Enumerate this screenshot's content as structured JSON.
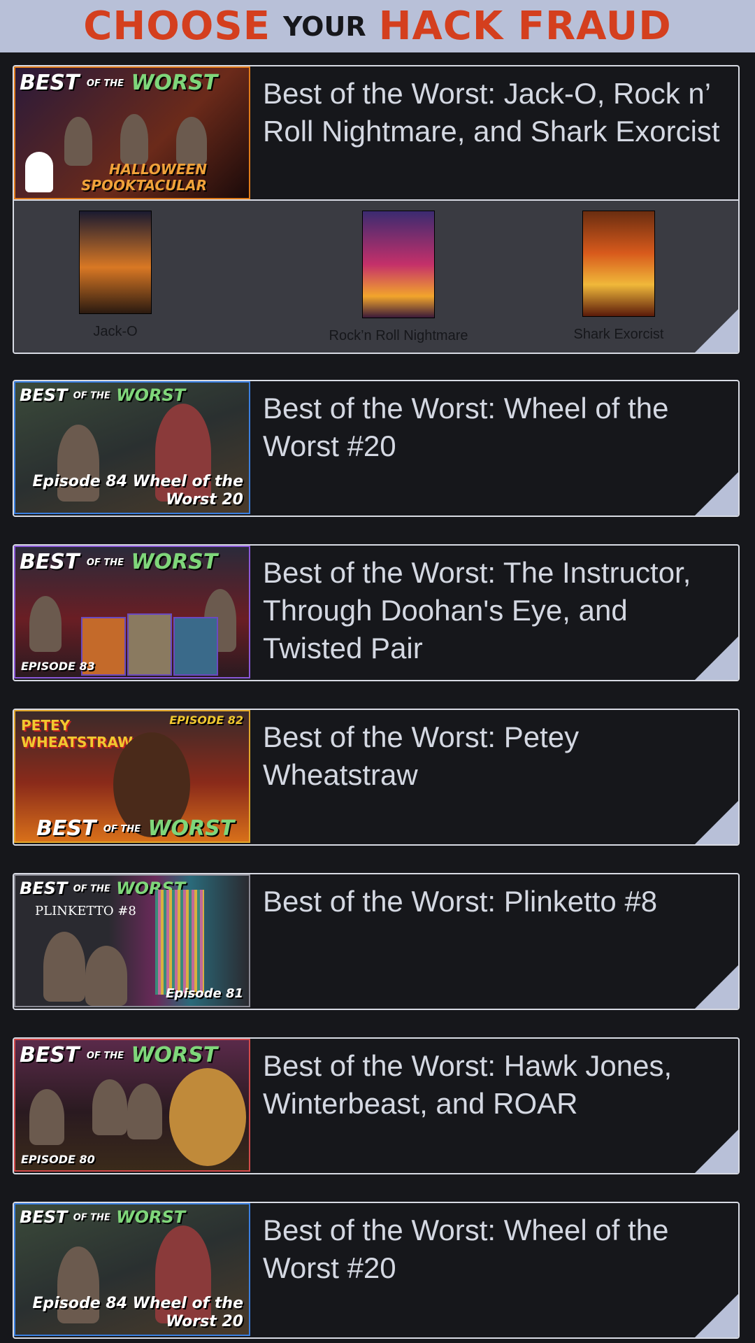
{
  "header": {
    "word1": "CHOOSE",
    "word2": "YOUR",
    "word3": "HACK FRAUD"
  },
  "featured": {
    "title": "Best of the Worst: Jack-O, Rock n’ Roll Nightmare, and Shark Exorcist",
    "movies": [
      {
        "label": "Jack-O"
      },
      {
        "label": "Rock’n Roll Nightmare"
      },
      {
        "label": "Shark Exorcist"
      }
    ]
  },
  "episodes": [
    {
      "title": "Best of the Worst: Wheel of the Worst #20"
    },
    {
      "title": "Best of the Worst: The Instructor, Through Doohan's Eye, and Twisted Pair"
    },
    {
      "title": "Best of the Worst: Petey Wheatstraw"
    },
    {
      "title": "Best of the Worst: Plinketto #8"
    },
    {
      "title": "Best of the Worst: Hawk Jones, Winterbeast, and ROAR"
    },
    {
      "title": "Best of the Worst: Wheel of the Worst #20"
    }
  ],
  "thumb_text": {
    "best": "BEST",
    "of_the": "OF THE",
    "worst": "WORST",
    "t0": "HALLOWEEN SPOOKTACULAR",
    "t1": "Episode 84 Wheel of the Worst 20",
    "t2": "EPISODE 83",
    "t3": "EPISODE 82",
    "t4": "Episode 81",
    "t4b": "PLINKETTO #8",
    "t5": "EPISODE 80",
    "t6": "Episode 84 Wheel of the Worst 20"
  },
  "colors": {
    "accent": "#d43f1e",
    "header_bg": "#b8c0d8",
    "page_bg": "#16171b",
    "text": "#d4d8e2"
  }
}
